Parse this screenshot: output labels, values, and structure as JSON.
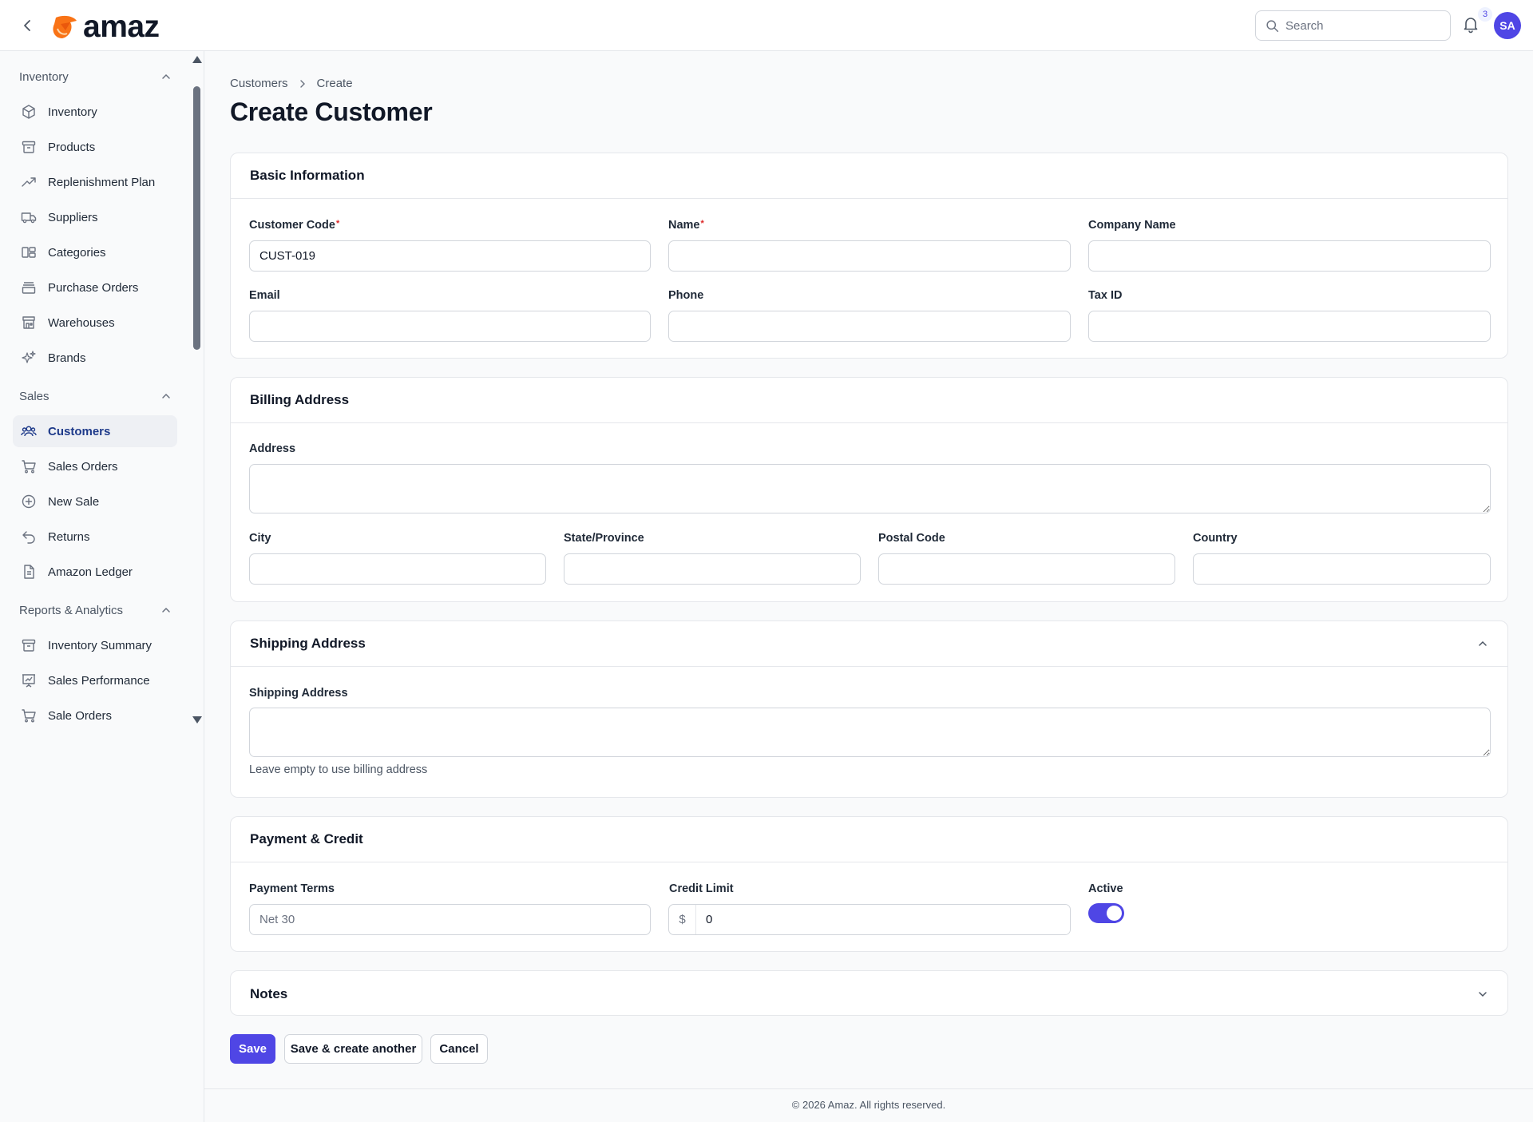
{
  "app": {
    "logo_text": "amaz"
  },
  "header": {
    "search_placeholder": "Search",
    "notification_count": "3",
    "avatar_initials": "SA"
  },
  "sidebar": {
    "groups": [
      {
        "label": "Inventory",
        "items": [
          {
            "label": "Inventory",
            "icon": "cube-icon"
          },
          {
            "label": "Products",
            "icon": "archive-box-icon"
          },
          {
            "label": "Replenishment Plan",
            "icon": "trending-up-icon"
          },
          {
            "label": "Suppliers",
            "icon": "truck-icon"
          },
          {
            "label": "Categories",
            "icon": "squares-icon"
          },
          {
            "label": "Purchase Orders",
            "icon": "inbox-stack-icon"
          },
          {
            "label": "Warehouses",
            "icon": "building-storefront-icon"
          },
          {
            "label": "Brands",
            "icon": "sparkles-icon"
          }
        ]
      },
      {
        "label": "Sales",
        "items": [
          {
            "label": "Customers",
            "icon": "user-group-icon",
            "active": true
          },
          {
            "label": "Sales Orders",
            "icon": "shopping-cart-icon"
          },
          {
            "label": "New Sale",
            "icon": "plus-circle-icon"
          },
          {
            "label": "Returns",
            "icon": "arrow-uturn-left-icon"
          },
          {
            "label": "Amazon Ledger",
            "icon": "document-icon"
          }
        ]
      },
      {
        "label": "Reports & Analytics",
        "items": [
          {
            "label": "Inventory Summary",
            "icon": "archive-box-icon"
          },
          {
            "label": "Sales Performance",
            "icon": "presentation-chart-icon"
          },
          {
            "label": "Sale Orders",
            "icon": "shopping-cart-icon"
          }
        ]
      }
    ]
  },
  "breadcrumb": {
    "parent": "Customers",
    "current": "Create"
  },
  "page": {
    "title": "Create Customer"
  },
  "basic": {
    "title": "Basic Information",
    "customer_code_label": "Customer Code",
    "customer_code_value": "CUST-019",
    "name_label": "Name",
    "company_label": "Company Name",
    "email_label": "Email",
    "phone_label": "Phone",
    "tax_label": "Tax ID",
    "required_mark": "*"
  },
  "billing": {
    "title": "Billing Address",
    "address_label": "Address",
    "city_label": "City",
    "state_label": "State/Province",
    "postal_label": "Postal Code",
    "country_label": "Country"
  },
  "shipping": {
    "title": "Shipping Address",
    "address_label": "Shipping Address",
    "hint": "Leave empty to use billing address"
  },
  "payment": {
    "title": "Payment & Credit",
    "terms_label": "Payment Terms",
    "terms_placeholder": "Net 30",
    "credit_label": "Credit Limit",
    "currency_prefix": "$",
    "credit_value": "0",
    "active_label": "Active",
    "active_on": true
  },
  "notes": {
    "title": "Notes"
  },
  "actions": {
    "save": "Save",
    "save_another": "Save & create another",
    "cancel": "Cancel"
  },
  "footer": {
    "text": "© 2026 Amaz. All rights reserved."
  },
  "colors": {
    "accent": "#4f46e5",
    "required": "#dc2626",
    "logo": "#f97316"
  }
}
